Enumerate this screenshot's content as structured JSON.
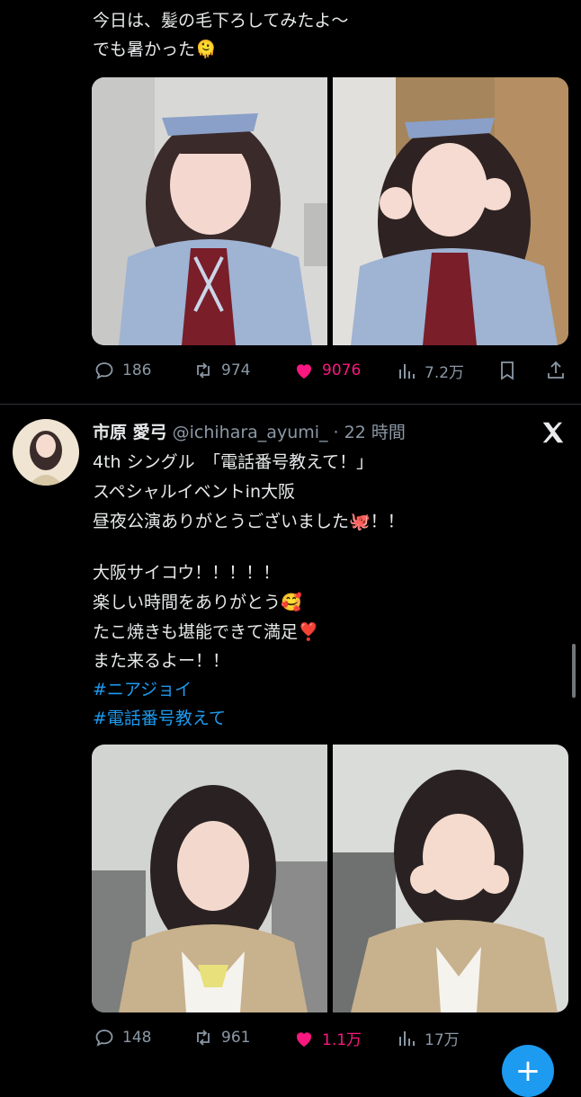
{
  "post1": {
    "lines": [
      "今日は、髪の毛下ろしてみたよ〜",
      "でも暑かった🫠"
    ],
    "metrics": {
      "replies": "186",
      "reposts": "974",
      "likes": "9076",
      "views": "7.2万"
    }
  },
  "post2": {
    "author_name": "市原 愛弓",
    "handle": "@ichihara_ayumi_",
    "time": "· 22 時間",
    "lines": [
      "4th シングル　「電話番号教えて！」",
      "スペシャルイベントin大阪",
      "昼夜公演ありがとうございました🐙！！",
      "",
      "大阪サイコウ！！！！！",
      "楽しい時間をありがとう🥰",
      "たこ焼きも堪能できて満足❣️",
      "また来るよー！！"
    ],
    "hashtags": [
      "#ニアジョイ",
      "#電話番号教えて"
    ],
    "metrics": {
      "replies": "148",
      "reposts": "961",
      "likes": "1.1万",
      "views": "17万"
    }
  },
  "colors": {
    "background": "#000000",
    "text": "#e7e9ea",
    "secondary": "#8b98a5",
    "like": "#f91880",
    "link": "#1d9bf0"
  }
}
